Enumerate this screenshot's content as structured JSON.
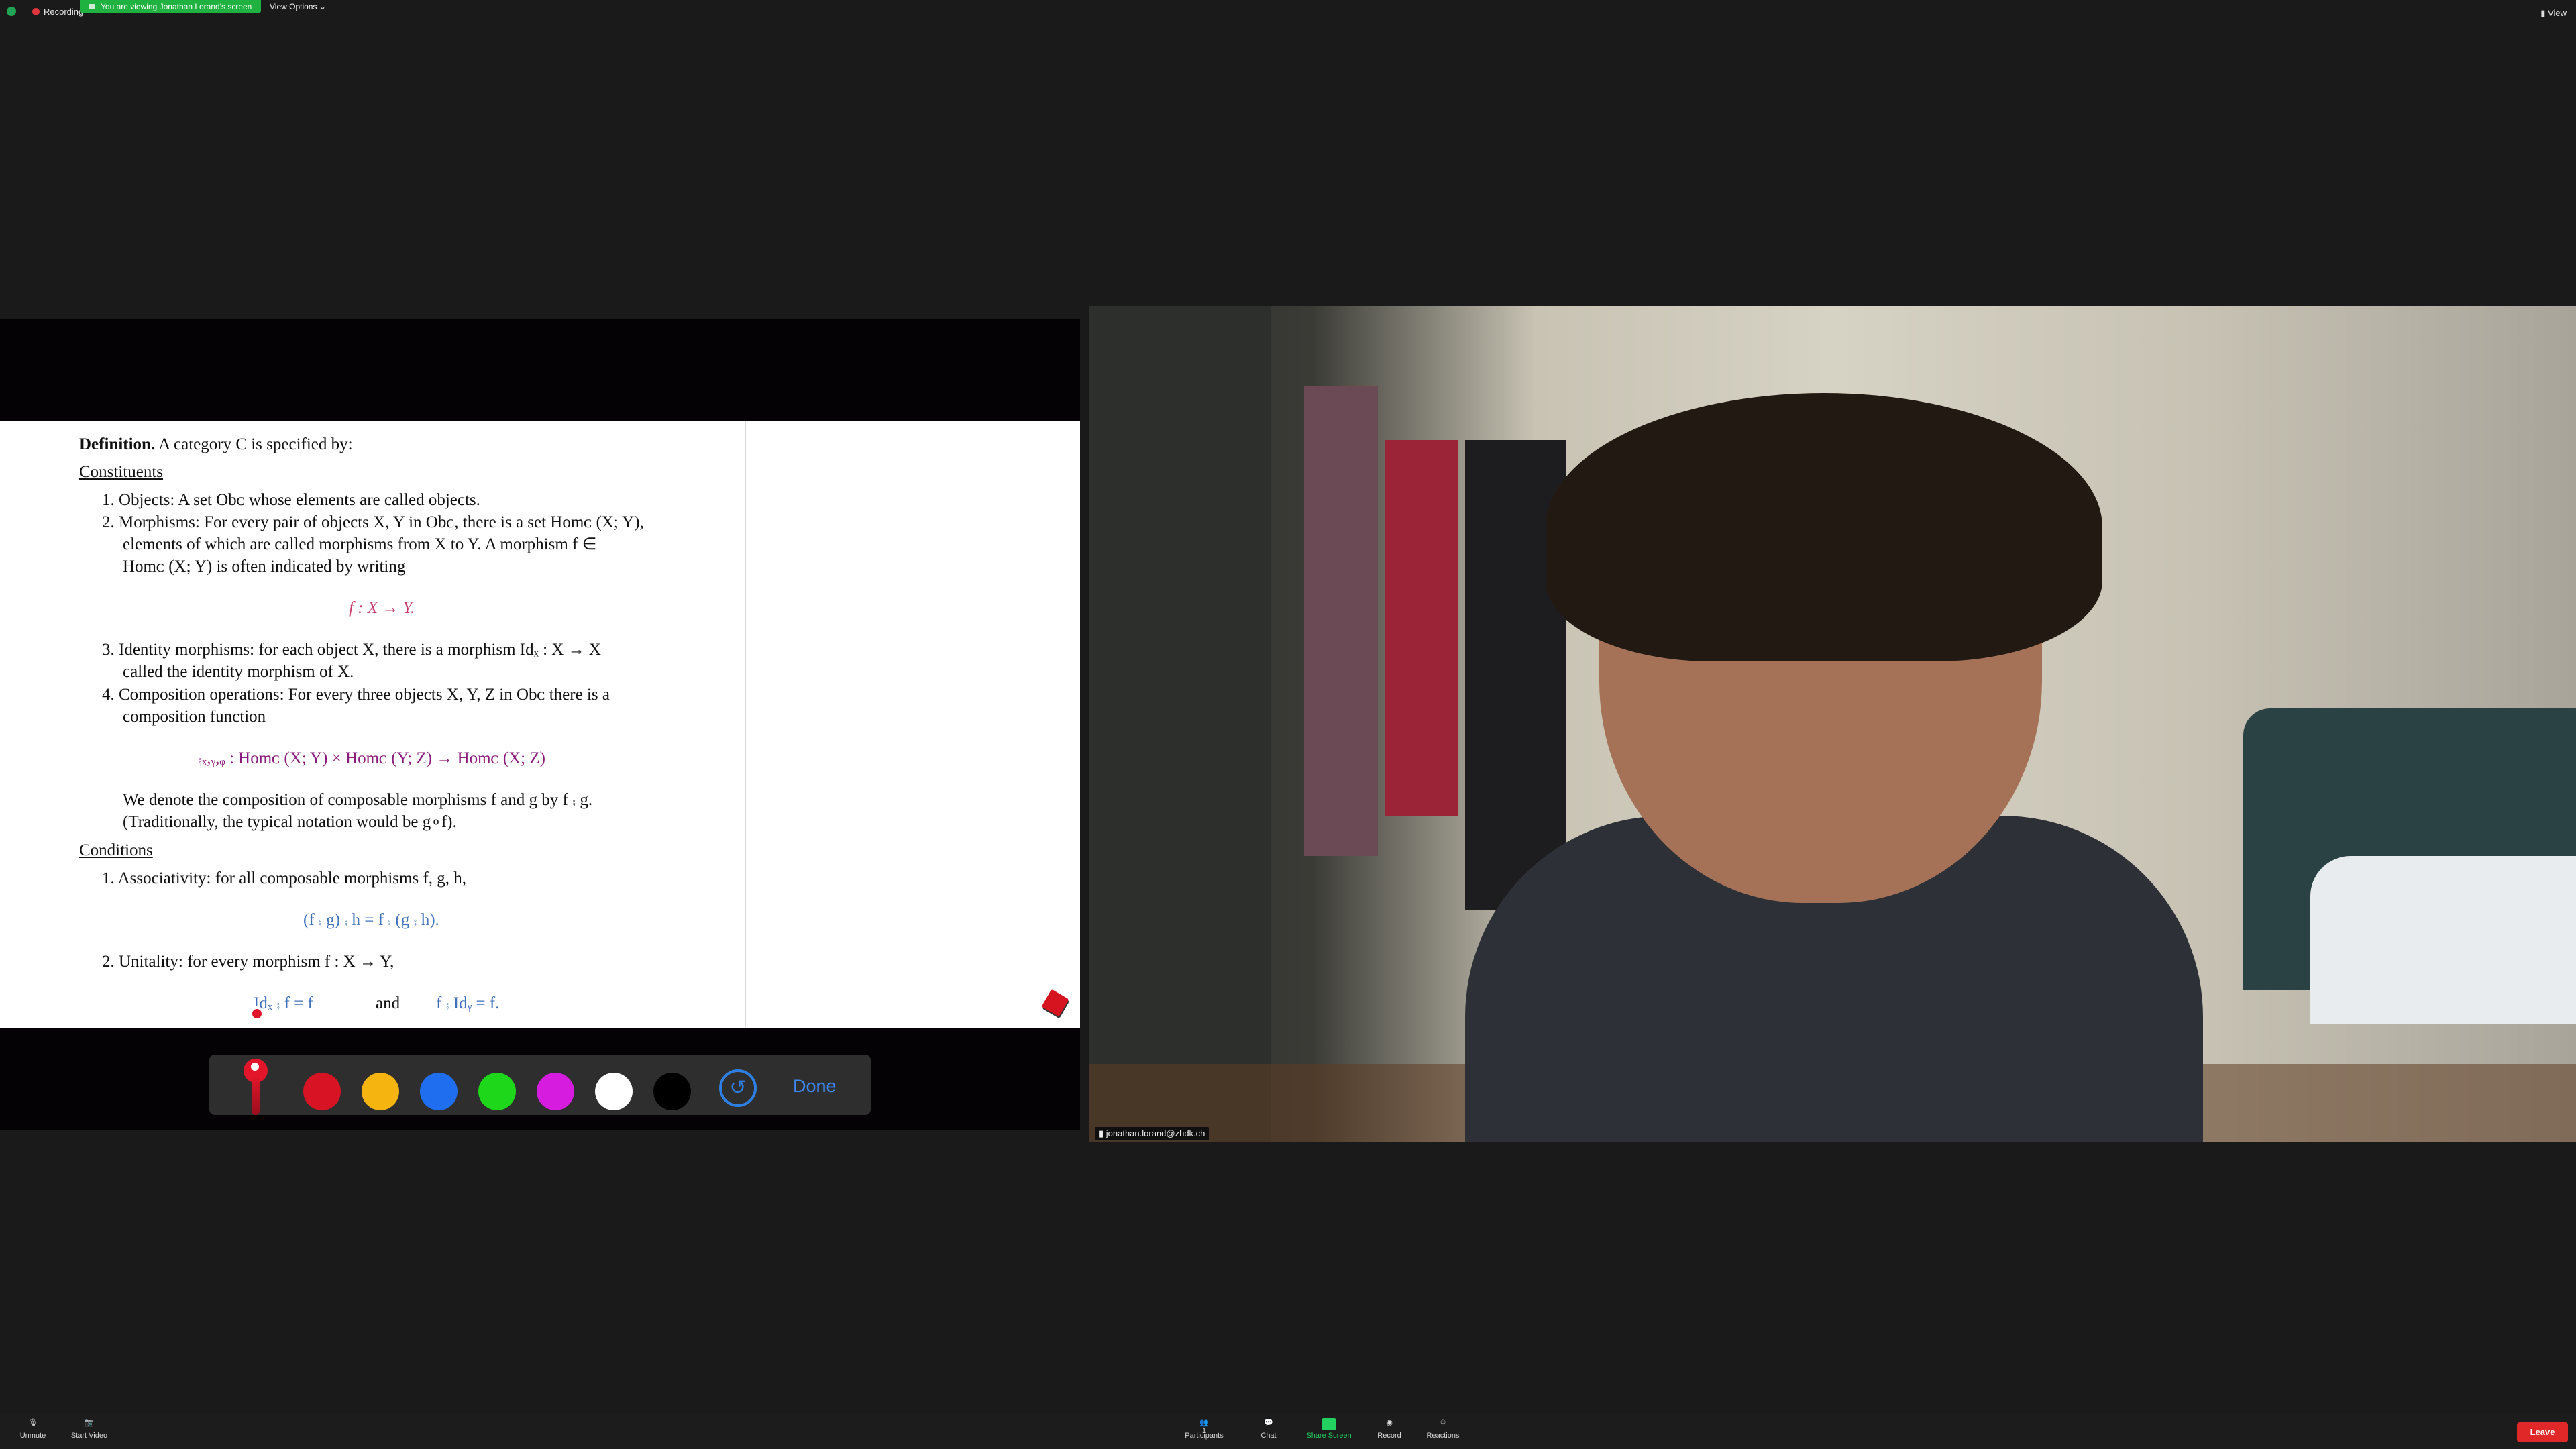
{
  "top": {
    "recording": "Recording",
    "viewing_banner": "You are viewing Jonathan Lorand's screen",
    "view_options": "View Options",
    "view_button": "View"
  },
  "doc": {
    "def_label": "Definition.",
    "def_text": "A category C is specified by:",
    "constituents": "Constituents",
    "l1": "1.  Objects: A set Obᴄ whose elements are called objects.",
    "l2a": "2.  Morphisms: For every pair of objects X, Y in Obᴄ, there is a set Homᴄ (X; Y),",
    "l2b": "elements of which are called morphisms from X to Y. A morphism f ∈",
    "l2c": "Homᴄ (X; Y) is often indicated by writing",
    "eq1": "f : X → Y.",
    "l3a": "3.  Identity morphisms: for each object X, there is a morphism Idₓ : X → X",
    "l3b": "called the identity morphism of X.",
    "l4a": "4.  Composition operations: For every three objects X, Y, Z in Obᴄ there is a",
    "l4b": "composition function",
    "eq2": "⨾ₓ,ᵧ,ᵩ : Homᴄ (X; Y) × Homᴄ (Y; Z) → Homᴄ (X; Z)",
    "l5a": "We denote the composition of composable morphisms f and g by f ⨾ g.",
    "l5b": "(Traditionally, the typical notation would be g∘f).",
    "conditions": "Conditions",
    "c1": "1.  Associativity: for all composable morphisms f, g, h,",
    "eq3": "(f ⨾ g) ⨾ h = f ⨾ (g ⨾ h).",
    "c2": "2.  Unitality: for every morphism f : X → Y,",
    "eq4a": "Idₓ ⨾ f = f",
    "eq4and": "and",
    "eq4b": "f ⨾ Idᵧ = f."
  },
  "annotation": {
    "swatches": [
      "#d81424",
      "#f5b40f",
      "#1f6ef0",
      "#1ed61a",
      "#d61cde",
      "#ffffff",
      "#000000"
    ],
    "done": "Done",
    "undo_icon": "undo-icon",
    "pen_icon": "pin-pen-icon"
  },
  "video": {
    "name": "jonathan.lorand@zhdk.ch"
  },
  "bottom": {
    "unmute": "Unmute",
    "start_video": "Start Video",
    "participants": "Participants",
    "participants_count": "1",
    "chat": "Chat",
    "share_screen": "Share Screen",
    "record": "Record",
    "reactions": "Reactions",
    "leave": "Leave"
  },
  "colors": {
    "share_green": "#23d160",
    "leave_red": "#e02828",
    "accent_blue": "#3d8af7"
  }
}
